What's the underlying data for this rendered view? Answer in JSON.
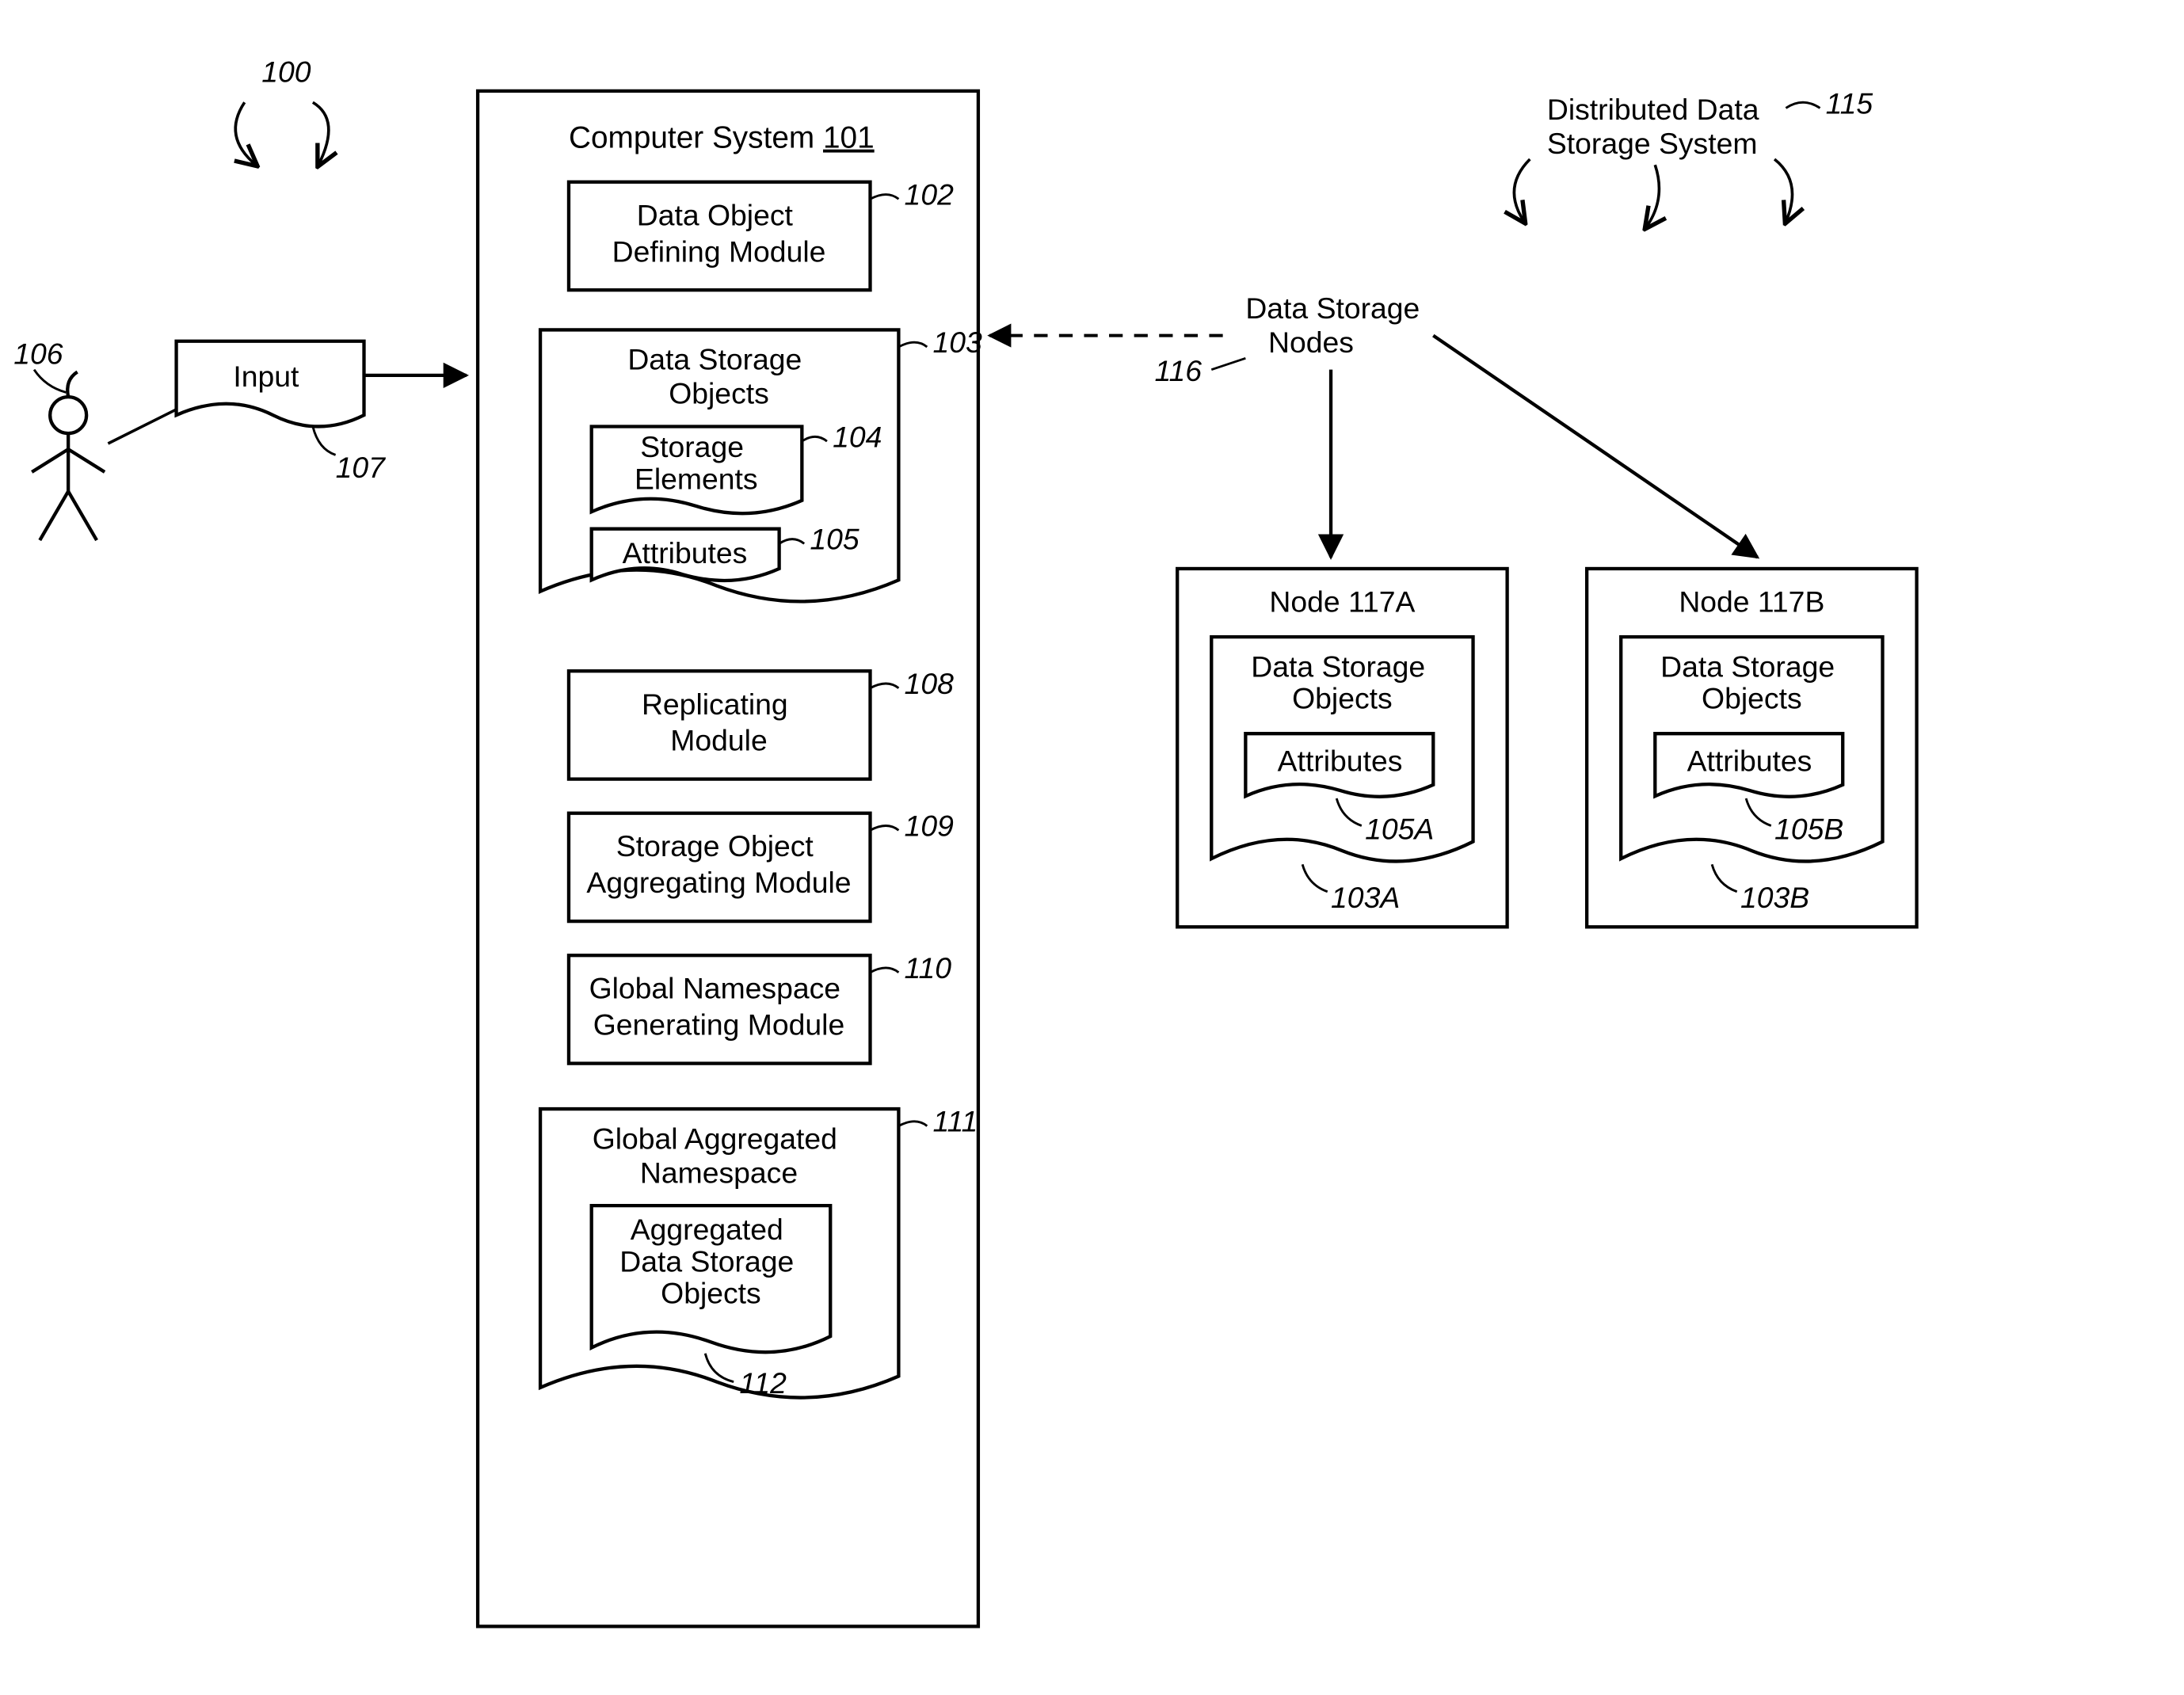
{
  "figure": {
    "ref100": "100",
    "computer_system_title": "Computer System",
    "computer_system_ref": "101",
    "data_object_defining_module": "Data Object\nDefining Module",
    "ref102": "102",
    "data_storage_objects": "Data Storage\nObjects",
    "ref103": "103",
    "storage_elements": "Storage\nElements",
    "ref104": "104",
    "attributes": "Attributes",
    "ref105": "105",
    "replicating_module": "Replicating\nModule",
    "ref108": "108",
    "storage_object_aggregating_module": "Storage Object\nAggregating Module",
    "ref109": "109",
    "global_namespace_generating_module": "Global Namespace\nGenerating Module",
    "ref110": "110",
    "global_aggregated_namespace": "Global Aggregated\nNamespace",
    "ref111": "111",
    "aggregated_data_storage_objects": "Aggregated\nData Storage\nObjects",
    "ref112": "112",
    "input": "Input",
    "ref107": "107",
    "ref106": "106",
    "distributed_data_storage_system": "Distributed Data\nStorage System",
    "ref115": "115",
    "data_storage_nodes": "Data Storage\nNodes",
    "ref116": "116",
    "node_a": "Node 117A",
    "node_a_dso": "Data Storage\nObjects",
    "node_a_attr": "Attributes",
    "ref105A": "105A",
    "ref103A": "103A",
    "node_b": "Node 117B",
    "node_b_dso": "Data Storage\nObjects",
    "node_b_attr": "Attributes",
    "ref105B": "105B",
    "ref103B": "103B"
  }
}
